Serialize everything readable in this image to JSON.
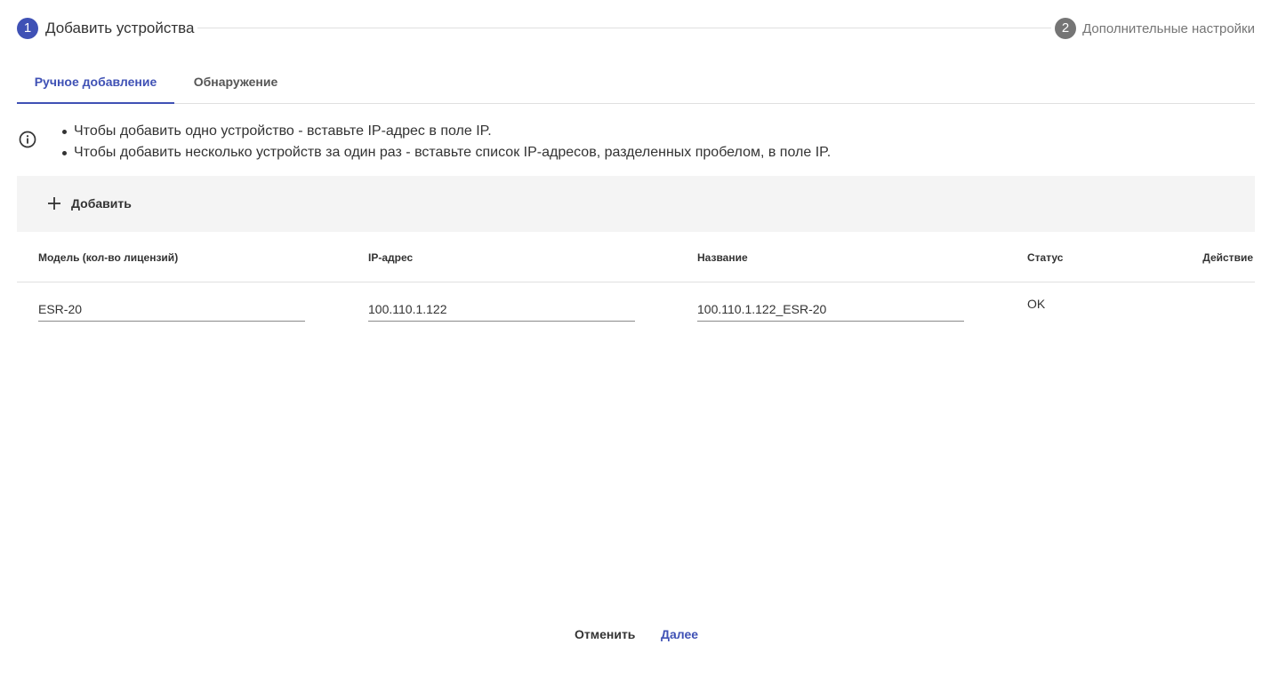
{
  "stepper": {
    "steps": [
      {
        "number": "1",
        "label": "Добавить устройства"
      },
      {
        "number": "2",
        "label": "Дополнительные настройки"
      }
    ]
  },
  "tabs": [
    {
      "label": "Ручное добавление"
    },
    {
      "label": "Обнаружение"
    }
  ],
  "info": {
    "icon": "info-circle-icon",
    "items": [
      "Чтобы добавить одно устройство - вставьте IP-адрес в поле IP.",
      "Чтобы добавить несколько устройств за один раз - вставьте список IP-адресов, разделенных пробелом, в поле IP."
    ]
  },
  "toolbar": {
    "add_label": "Добавить",
    "add_icon": "plus-icon"
  },
  "table": {
    "columns": [
      "Модель (кол-во лицензий)",
      "IP-адрес",
      "Название",
      "Статус",
      "Действие"
    ],
    "rows": [
      {
        "model": "ESR-20",
        "ip": "100.110.1.122",
        "name": "100.110.1.122_ESR-20",
        "status": "OK"
      }
    ]
  },
  "footer": {
    "cancel_label": "Отменить",
    "next_label": "Далее"
  },
  "colors": {
    "accent": "#3f51b5",
    "inactive_step": "#757575",
    "toolbar_bg": "#f4f4f4"
  }
}
